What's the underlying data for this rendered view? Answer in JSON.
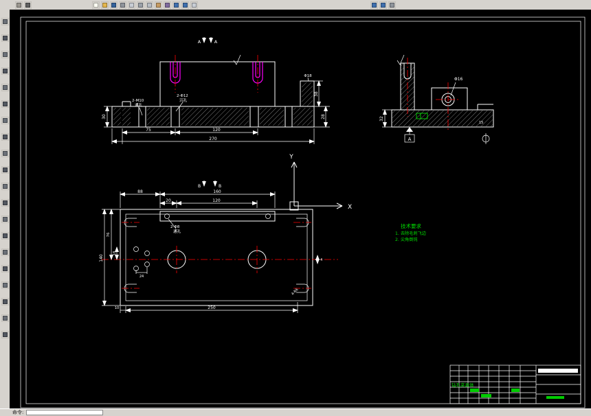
{
  "colors": {
    "canvas": "#000000",
    "line": "#ffffff",
    "centerline": "#ff0000",
    "highlight": "#ff00ff",
    "annotation_green": "#00dd00",
    "chrome": "#d6d3ce"
  },
  "command": {
    "label": "命令:"
  },
  "toolbars": {
    "top_small": [
      {
        "name": "toolbar-grip",
        "color": "#9a968f"
      },
      {
        "name": "style-list",
        "color": "#5f5f5f"
      }
    ],
    "top_main": [
      {
        "name": "new-file",
        "color": "#fdfdf2"
      },
      {
        "name": "open-file",
        "color": "#e3b64d"
      },
      {
        "name": "save-file",
        "color": "#35639c"
      },
      {
        "name": "plot",
        "color": "#8f949b"
      },
      {
        "name": "plot-preview",
        "color": "#c8cdd4"
      },
      {
        "name": "cut",
        "color": "#9aa0a8"
      },
      {
        "name": "copy",
        "color": "#b9bec5"
      },
      {
        "name": "paste",
        "color": "#c59a62"
      },
      {
        "name": "match-properties",
        "color": "#7f6a9e"
      },
      {
        "name": "undo",
        "color": "#3f6fae"
      },
      {
        "name": "redo",
        "color": "#3f6fae"
      },
      {
        "name": "pan",
        "color": "#c8cdd4"
      }
    ],
    "top_zoom": [
      {
        "name": "zoom-window",
        "color": "#3f6fae"
      },
      {
        "name": "zoom-realtime",
        "color": "#3f6fae"
      },
      {
        "name": "zoom-previous",
        "color": "#8f949b"
      }
    ],
    "left": [
      {
        "name": "line",
        "color": "#6b7078"
      },
      {
        "name": "construction-line",
        "color": "#525760"
      },
      {
        "name": "polyline",
        "color": "#6b7078"
      },
      {
        "name": "polygon",
        "color": "#525760"
      },
      {
        "name": "rectangle",
        "color": "#6b7078"
      },
      {
        "name": "arc",
        "color": "#525760"
      },
      {
        "name": "circle",
        "color": "#6b7078"
      },
      {
        "name": "spline",
        "color": "#525760"
      },
      {
        "name": "ellipse",
        "color": "#6b7078"
      },
      {
        "name": "insert-block",
        "color": "#525760"
      },
      {
        "name": "make-block",
        "color": "#6b7078"
      },
      {
        "name": "point",
        "color": "#525760"
      },
      {
        "name": "hatch",
        "color": "#6b7078"
      },
      {
        "name": "region",
        "color": "#525760"
      },
      {
        "name": "multiline-text",
        "color": "#6b7078"
      },
      {
        "name": "erase",
        "color": "#525760"
      },
      {
        "name": "copy-object",
        "color": "#6b7078"
      },
      {
        "name": "mirror",
        "color": "#525760"
      },
      {
        "name": "offset",
        "color": "#6b7078"
      },
      {
        "name": "array",
        "color": "#525760"
      }
    ]
  },
  "front_view": {
    "section_a_left": "A",
    "section_a_right": "A",
    "note_m10_1": "2-M10",
    "note_m10_2": "通孔",
    "note_c12_1": "2-Φ12",
    "note_c12_2": "沉孔",
    "dia_col": "Φ18",
    "dim_75": "75",
    "dim_120": "120",
    "dim_270": "270",
    "dim_r38": "38",
    "dim_r28": "28",
    "dim_l30": "30"
  },
  "side_view": {
    "dia16": "Φ16",
    "datum": "A",
    "dim_32": "32",
    "dim_15": "15"
  },
  "plan_view": {
    "b_left": "B",
    "b_right": "B",
    "dim_160": "160",
    "dim_120": "120",
    "dim_20": "20",
    "dim_88": "88",
    "dim_250": "250",
    "dim_10": "10",
    "dim_140": "140",
    "dim_76": "76",
    "dim_18": "18",
    "dim_24": "24",
    "dim_4": "4",
    "note_c8_1": "2-Φ8",
    "note_c8_2": "通孔",
    "corner_note": "4-R6"
  },
  "ucs": {
    "x_label": "X",
    "y_label": "Y"
  },
  "tech_notes": {
    "title": "技术要求",
    "line1": "1. 去除毛刺飞边",
    "line2": "2. 尖角倒钝"
  },
  "title_block": {
    "part_name": "钻孔夹具体"
  }
}
